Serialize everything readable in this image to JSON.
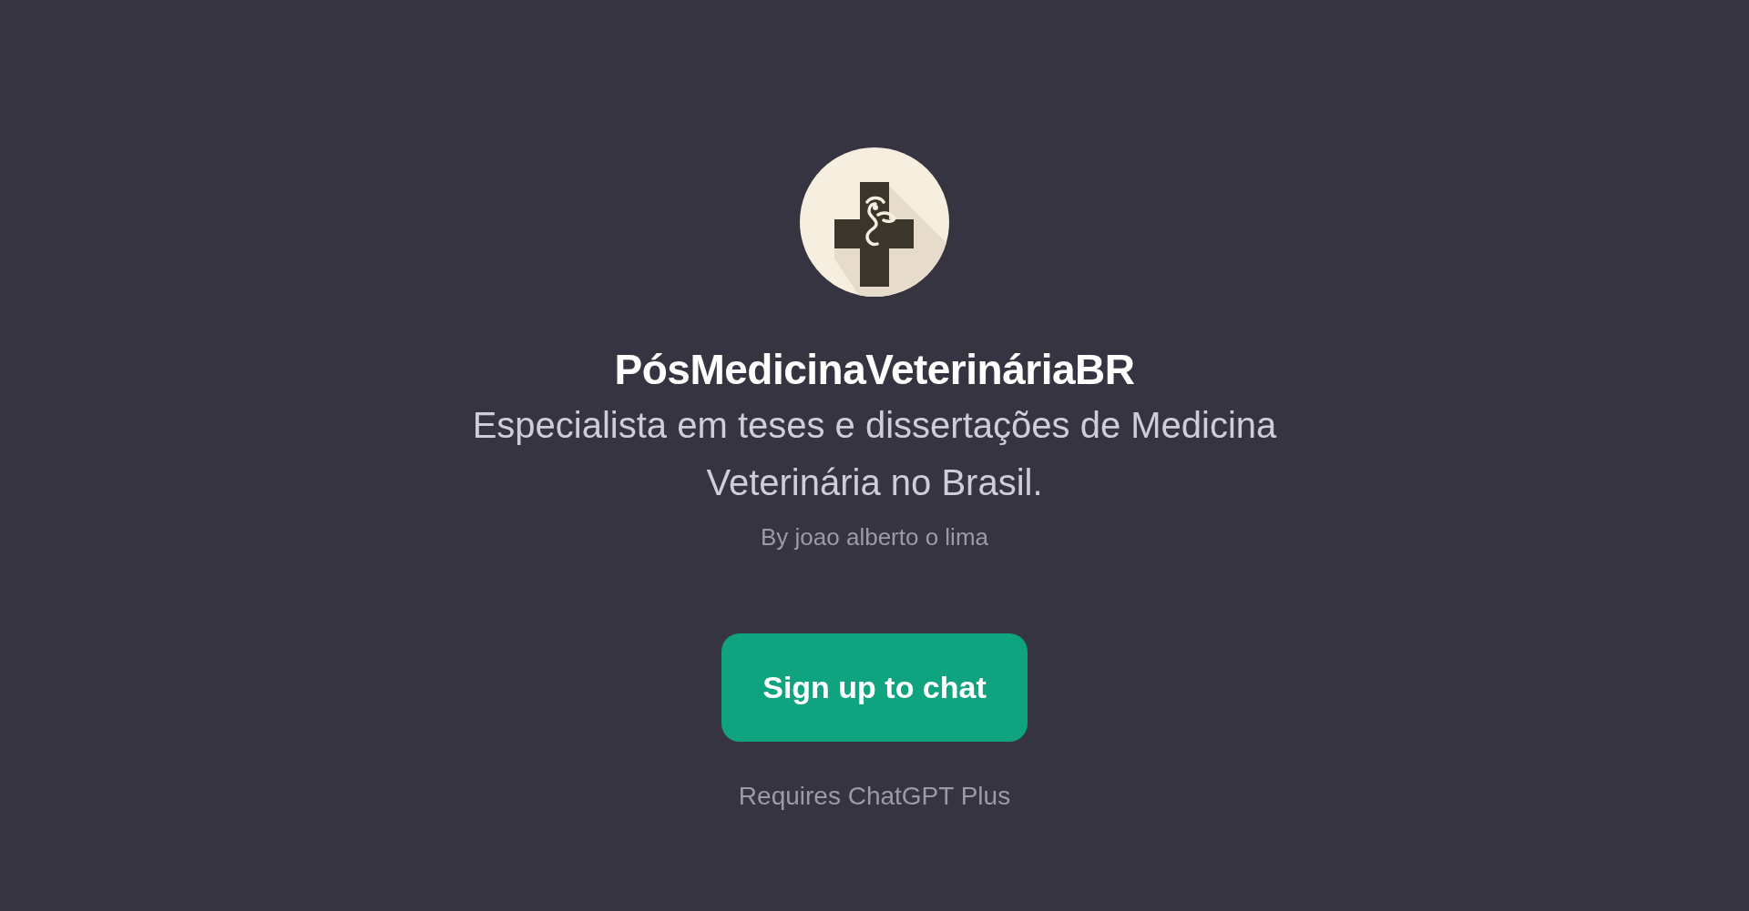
{
  "gpt": {
    "name": "PósMedicinaVeterináriaBR",
    "description": "Especialista em teses e dissertações de Medicina Veterinária no Brasil.",
    "author": "By joao alberto o lima"
  },
  "button": {
    "label": "Sign up to chat"
  },
  "note": "Requires ChatGPT Plus"
}
